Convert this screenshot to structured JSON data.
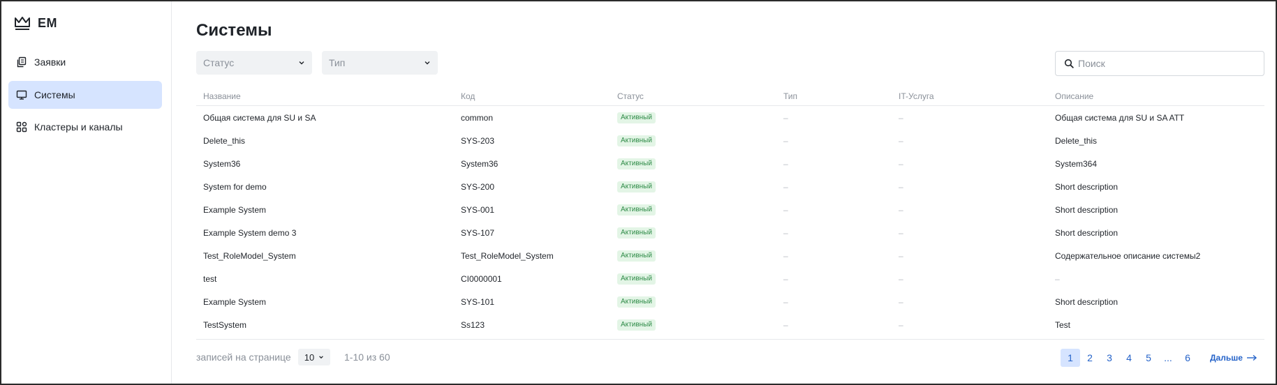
{
  "app": {
    "logo_text": "EM"
  },
  "sidebar": {
    "items": [
      {
        "label": "Заявки",
        "icon": "document-copy-icon",
        "active": false
      },
      {
        "label": "Системы",
        "icon": "monitor-icon",
        "active": true
      },
      {
        "label": "Кластеры и каналы",
        "icon": "grid-icon",
        "active": false
      }
    ]
  },
  "page": {
    "title": "Системы"
  },
  "filters": {
    "status_placeholder": "Статус",
    "type_placeholder": "Тип"
  },
  "search": {
    "placeholder": "Поиск",
    "value": ""
  },
  "table": {
    "columns": [
      "Название",
      "Код",
      "Статус",
      "Тип",
      "IT-Услуга",
      "Описание"
    ],
    "rows": [
      [
        "Общая система для SU и SA",
        "common",
        "Активный",
        "–",
        "–",
        "Общая система для SU и SA ATT"
      ],
      [
        "Delete_this",
        "SYS-203",
        "Активный",
        "–",
        "–",
        "Delete_this"
      ],
      [
        "System36",
        "System36",
        "Активный",
        "–",
        "–",
        "System364"
      ],
      [
        "System for demo",
        "SYS-200",
        "Активный",
        "–",
        "–",
        "Short description"
      ],
      [
        "Example System",
        "SYS-001",
        "Активный",
        "–",
        "–",
        "Short description"
      ],
      [
        "Example System demo 3",
        "SYS-107",
        "Активный",
        "–",
        "–",
        "Short description"
      ],
      [
        "Test_RoleModel_System",
        "Test_RoleModel_System",
        "Активный",
        "–",
        "–",
        "Содержательное описание системы2"
      ],
      [
        "test",
        "CI0000001",
        "Активный",
        "–",
        "–",
        "–"
      ],
      [
        "Example System",
        "SYS-101",
        "Активный",
        "–",
        "–",
        "Short description"
      ],
      [
        "TestSystem",
        "Ss123",
        "Активный",
        "–",
        "–",
        "Test"
      ]
    ]
  },
  "footer": {
    "per_page_label": "записей на странице",
    "per_page_value": "10",
    "range_text": "1-10 из 60",
    "pages": [
      "1",
      "2",
      "3",
      "4",
      "5"
    ],
    "ellipsis": "...",
    "last_page": "6",
    "current_page": "1",
    "next_label": "Дальше"
  },
  "colors": {
    "accent": "#2563c9",
    "active_nav_bg": "#d6e4ff",
    "badge_bg": "#e3f5e6",
    "badge_text": "#2e8b47"
  }
}
